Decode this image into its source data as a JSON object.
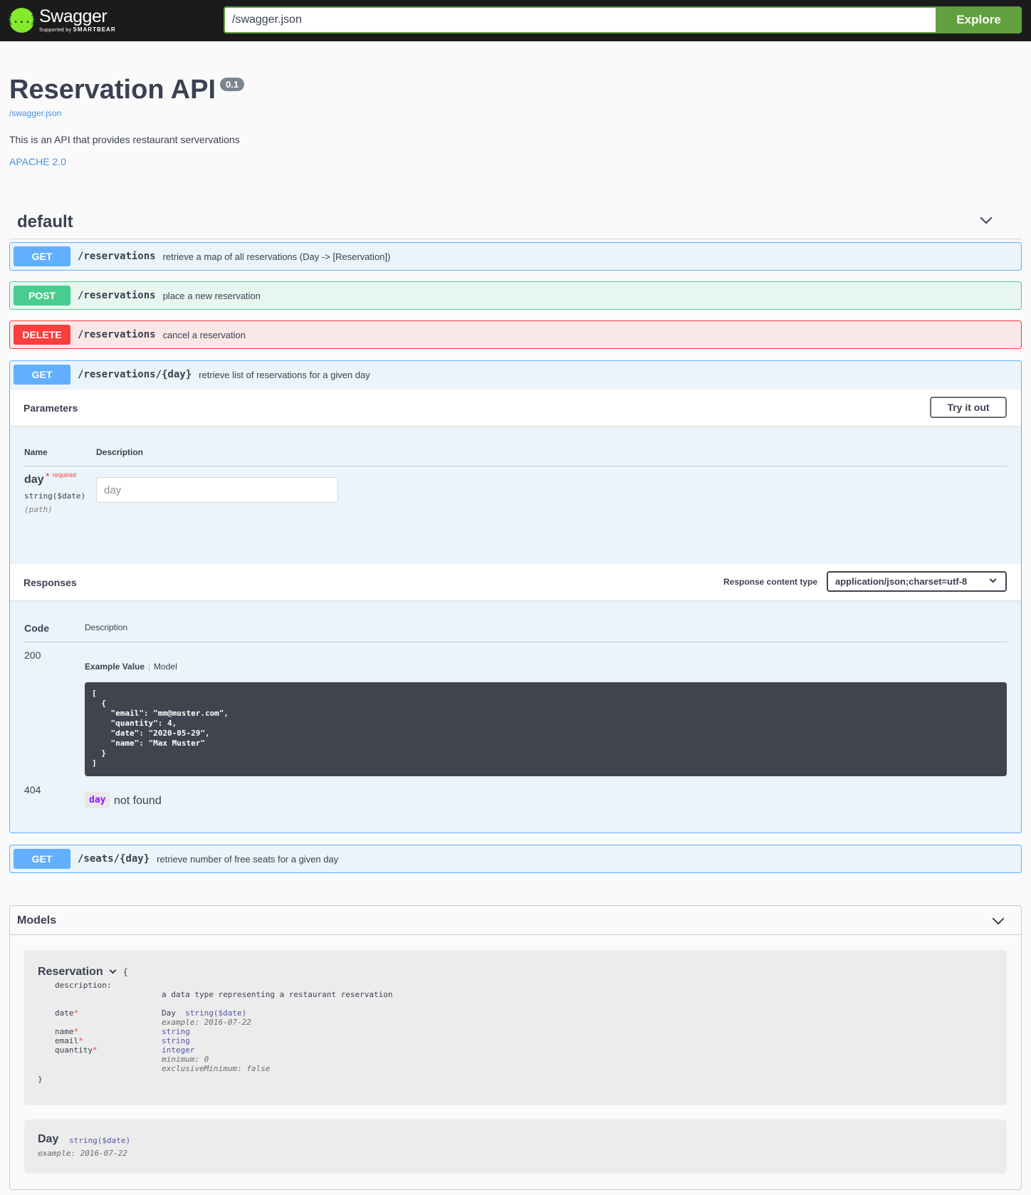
{
  "topbar": {
    "logo_mark": "{...}",
    "logo_name": "Swagger",
    "logo_sub_prefix": "Supported by",
    "logo_sub_brand": "SMARTBEAR",
    "url_value": "/swagger.json",
    "explore_label": "Explore",
    "accent_color": "#62a03f"
  },
  "info": {
    "title": "Reservation API",
    "version": "0.1",
    "spec_url": "/swagger.json",
    "description": "This is an API that provides restaurant servervations",
    "license": "APACHE 2.0"
  },
  "tag": {
    "name": "default"
  },
  "operations": [
    {
      "method": "GET",
      "path": "/reservations",
      "summary": "retrieve a map of all reservations (Day -> [Reservation])"
    },
    {
      "method": "POST",
      "path": "/reservations",
      "summary": "place a new reservation"
    },
    {
      "method": "DELETE",
      "path": "/reservations",
      "summary": "cancel a reservation"
    },
    {
      "method": "GET",
      "path": "/reservations/{day}",
      "summary": "retrieve list of reservations for a given day"
    },
    {
      "method": "GET",
      "path": "/seats/{day}",
      "summary": "retrieve number of free seats for a given day"
    }
  ],
  "expanded": {
    "parameters_title": "Parameters",
    "try_label": "Try it out",
    "col_name": "Name",
    "col_description": "Description",
    "param": {
      "name": "day",
      "star": "*",
      "required": "required",
      "type": "string($date)",
      "in": "(path)",
      "placeholder": "day"
    },
    "responses_title": "Responses",
    "content_type_label": "Response content type",
    "content_type_value": "application/json;charset=utf-8",
    "col_code": "Code",
    "col_resp_description": "Description",
    "responses": [
      {
        "code": "200",
        "example_tab": "Example Value",
        "model_tab": "Model",
        "example": "[\n  {\n    \"email\": \"mm@muster.com\",\n    \"quantity\": 4,\n    \"date\": \"2020-05-29\",\n    \"name\": \"Max Muster\"\n  }\n]"
      },
      {
        "code": "404",
        "chip": "day",
        "text": "not found"
      }
    ]
  },
  "models": {
    "title": "Models",
    "reservation": {
      "name": "Reservation",
      "brace_open": "{",
      "brace_close": "}",
      "description_key": "description:",
      "description_value": "a data type representing a restaurant reservation",
      "fields": [
        {
          "key": "date",
          "type_prefix": "Day",
          "type": "string($date)",
          "extra": [
            "example: 2016-07-22"
          ]
        },
        {
          "key": "name",
          "type": "string",
          "extra": []
        },
        {
          "key": "email",
          "type": "string",
          "extra": []
        },
        {
          "key": "quantity",
          "type": "integer",
          "extra": [
            "minimum: 0",
            "exclusiveMinimum: false"
          ]
        }
      ]
    },
    "day": {
      "name": "Day",
      "type": "string($date)",
      "example": "example: 2016-07-22"
    }
  },
  "colors": {
    "get": "#61affe",
    "post": "#49cc90",
    "delete": "#f93e3e"
  },
  "icons": {
    "collapse": "chevron-down-icon"
  }
}
